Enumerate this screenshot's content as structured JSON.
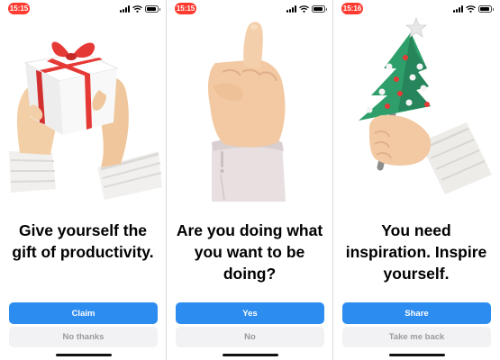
{
  "colors": {
    "time_pill": "#ff3b30",
    "primary_button": "#2d8cf0",
    "secondary_button": "#f2f2f4",
    "secondary_text": "#9a9a9f"
  },
  "screens": [
    {
      "time": "15:15",
      "illustration": "hands-holding-gift",
      "headline": "Give yourself the gift of productivity.",
      "primary_label": "Claim",
      "secondary_label": "No thanks"
    },
    {
      "time": "15:15",
      "illustration": "hand-pointing-up",
      "headline": "Are you doing what you want to be doing?",
      "primary_label": "Yes",
      "secondary_label": "No"
    },
    {
      "time": "15:16",
      "illustration": "hand-holding-christmas-tree",
      "headline": "You need inspiration. Inspire yourself.",
      "primary_label": "Share",
      "secondary_label": "Take me back"
    }
  ]
}
